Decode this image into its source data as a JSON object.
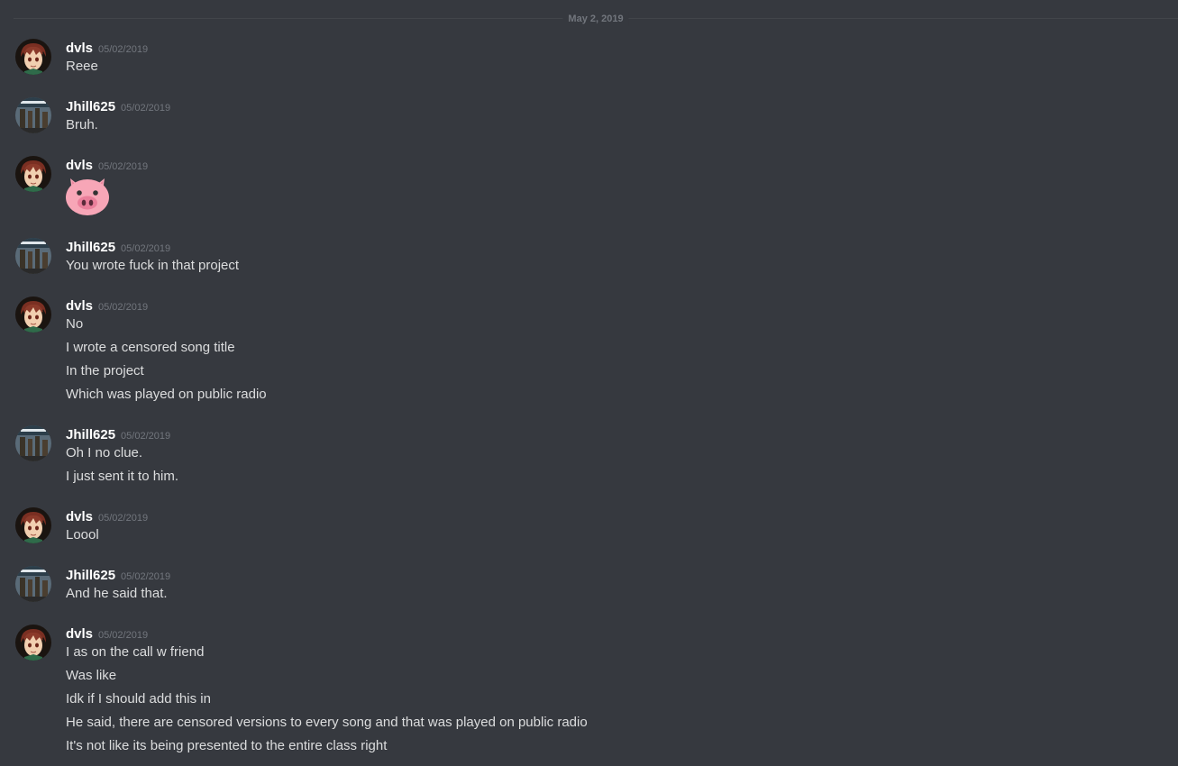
{
  "chat": {
    "date_divider": "May 2, 2019",
    "messages": [
      {
        "author": "dvls",
        "timestamp": "05/02/2019",
        "avatar": "dvls-avatar",
        "lines": [
          "Reee"
        ]
      },
      {
        "author": "Jhill625",
        "timestamp": "05/02/2019",
        "avatar": "jhill625-avatar",
        "lines": [
          "Bruh."
        ]
      },
      {
        "author": "dvls",
        "timestamp": "05/02/2019",
        "avatar": "dvls-avatar",
        "lines": [],
        "emoji": "pig-face-emoji"
      },
      {
        "author": "Jhill625",
        "timestamp": "05/02/2019",
        "avatar": "jhill625-avatar",
        "lines": [
          "You wrote fuck in that project"
        ]
      },
      {
        "author": "dvls",
        "timestamp": "05/02/2019",
        "avatar": "dvls-avatar",
        "lines": [
          "No",
          "I wrote a censored song title",
          "In the project",
          "Which was played on public radio"
        ]
      },
      {
        "author": "Jhill625",
        "timestamp": "05/02/2019",
        "avatar": "jhill625-avatar",
        "lines": [
          "Oh I no clue.",
          "I just sent it to him."
        ]
      },
      {
        "author": "dvls",
        "timestamp": "05/02/2019",
        "avatar": "dvls-avatar",
        "lines": [
          "Loool"
        ]
      },
      {
        "author": "Jhill625",
        "timestamp": "05/02/2019",
        "avatar": "jhill625-avatar",
        "lines": [
          "And he said that."
        ]
      },
      {
        "author": "dvls",
        "timestamp": "05/02/2019",
        "avatar": "dvls-avatar",
        "lines": [
          "I as on the call w friend",
          "Was like",
          "Idk if I should add this in",
          "He said, there are censored versions to every song and that was played on public radio",
          "It's not like its being presented to the entire class right"
        ]
      }
    ]
  },
  "colors": {
    "background": "#36393f",
    "author": "#ffffff",
    "timestamp": "#72767d",
    "message_text": "#dcddde",
    "divider": "#42454a"
  }
}
